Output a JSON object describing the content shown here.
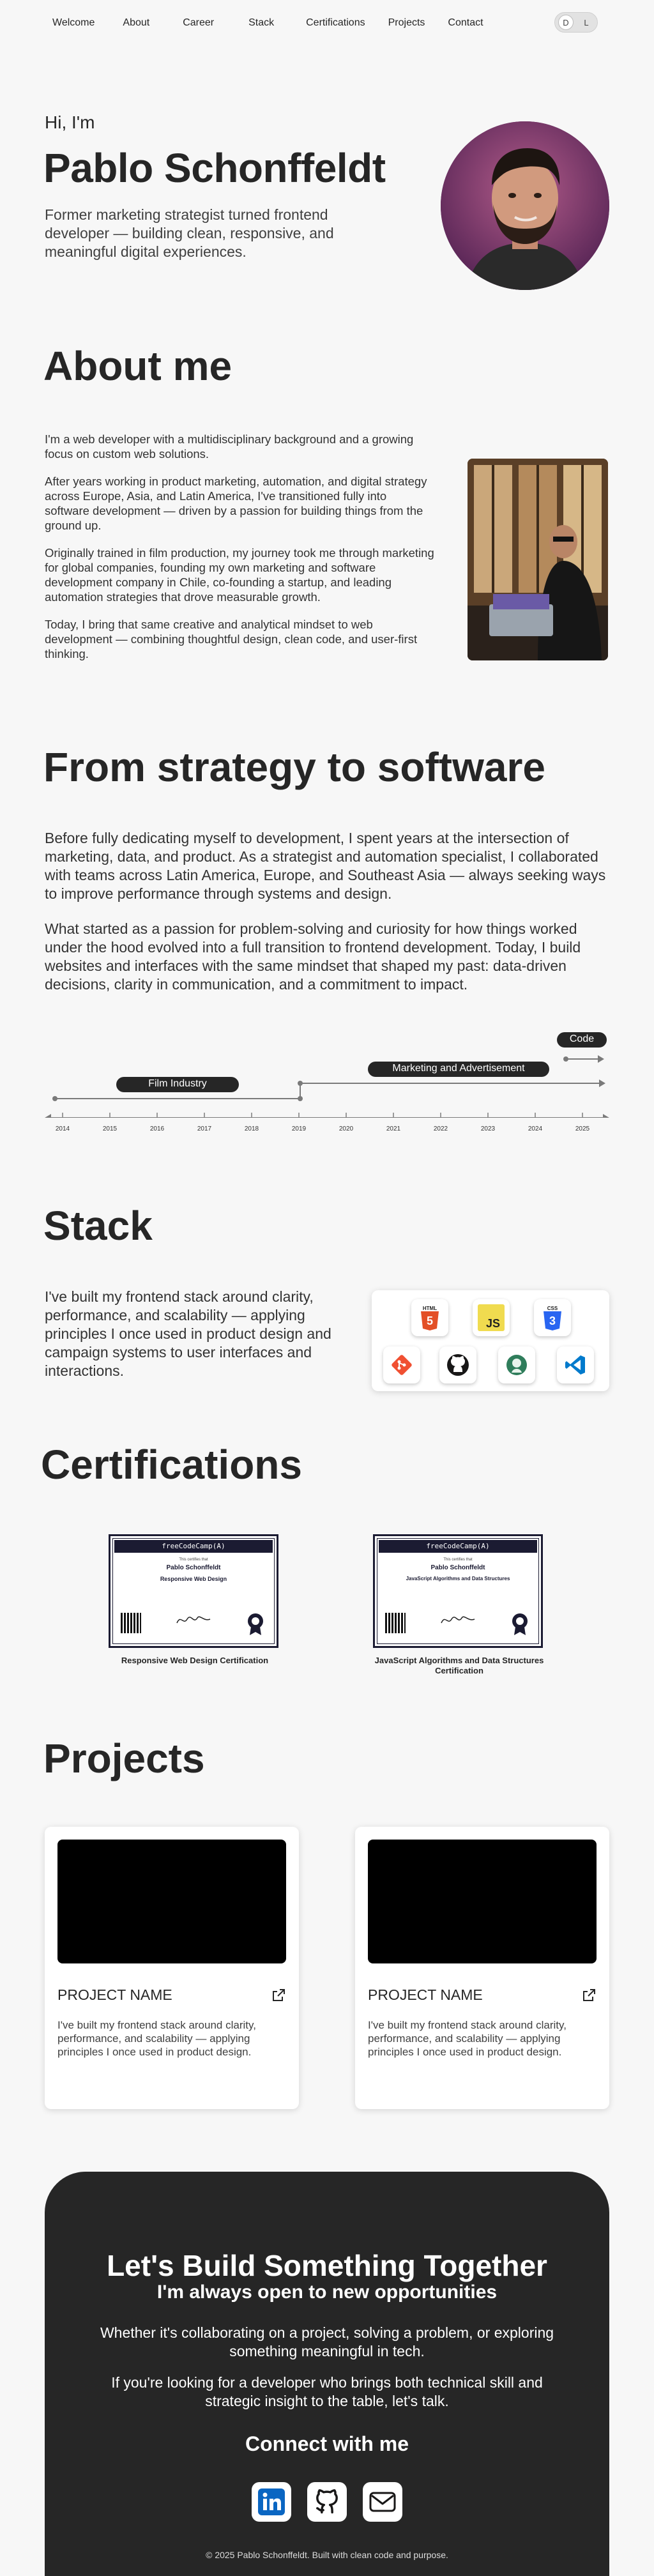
{
  "nav": {
    "links": [
      "Welcome",
      "About",
      "Career",
      "Stack",
      "Certifications",
      "Projects",
      "Contact"
    ],
    "toggle": {
      "dark_label": "D",
      "light_label": "L"
    }
  },
  "hero": {
    "greeting": "Hi, I'm",
    "name": "Pablo Schonffeldt",
    "tagline": "Former marketing strategist turned frontend developer — building clean, responsive, and meaningful digital experiences."
  },
  "about": {
    "title": "About me",
    "paragraphs": [
      "I'm a web developer with a multidisciplinary background and a growing focus on custom web solutions.",
      "After years working in product marketing, automation, and digital strategy across Europe, Asia, and Latin America, I've transitioned fully into software development — driven by a passion for building things from the ground up.",
      "Originally trained in film production, my journey took me through marketing for global companies, founding my own marketing and software development company in Chile, co-founding a startup, and leading automation strategies that drove measurable growth.",
      "Today, I bring that same creative and analytical mindset to web development — combining thoughtful design, clean code, and user-first thinking."
    ]
  },
  "career": {
    "title": "From strategy to software",
    "paragraphs": [
      "Before fully dedicating myself to development, I spent years at the intersection of marketing, data, and product. As a strategist and automation specialist, I collaborated with teams across Latin America, Europe, and Southeast Asia — always seeking ways to improve performance through systems and design.",
      "What started as a passion for problem-solving and curiosity for how things worked under the hood evolved into a full transition to frontend development. Today, I build websites and interfaces with the same mindset that shaped my past: data-driven decisions, clarity in communication, and a commitment to impact."
    ],
    "timeline": {
      "phases": [
        "Film Industry",
        "Marketing and Advertisement",
        "Code"
      ],
      "years": [
        "2014",
        "2015",
        "2016",
        "2017",
        "2018",
        "2019",
        "2020",
        "2021",
        "2022",
        "2023",
        "2024",
        "2025"
      ]
    }
  },
  "stack": {
    "title": "Stack",
    "text": "I've built my frontend stack around clarity, performance, and scalability — applying principles I once used in product design and campaign systems to user interfaces and interactions.",
    "icons": [
      {
        "name": "html5-icon",
        "label": "HTML",
        "badge": "5",
        "color": "#e34f26"
      },
      {
        "name": "javascript-icon",
        "label": "JS",
        "color": "#f0db4f"
      },
      {
        "name": "css3-icon",
        "label": "CSS",
        "badge": "3",
        "color": "#2965f1"
      },
      {
        "name": "git-icon",
        "color": "#f05032"
      },
      {
        "name": "github-icon",
        "color": "#181717"
      },
      {
        "name": "node-icon",
        "color": "#3c873a"
      },
      {
        "name": "vscode-icon",
        "color": "#007acc"
      }
    ]
  },
  "certifications": {
    "title": "Certifications",
    "items": [
      {
        "caption": "Responsive Web Design Certification",
        "brand": "freeCodeCamp(A)",
        "issuer_line": "This certifies that",
        "recipient": "Pablo Schonffeldt",
        "course": "Responsive Web Design"
      },
      {
        "caption": "JavaScript Algorithms and Data Structures Certification",
        "brand": "freeCodeCamp(A)",
        "issuer_line": "This certifies that",
        "recipient": "Pablo Schonffeldt",
        "course": "JavaScript Algorithms and Data Structures"
      }
    ]
  },
  "projects": {
    "title": "Projects",
    "items": [
      {
        "name": "PROJECT NAME",
        "description": "I've built my frontend stack around clarity, performance, and scalability — applying principles I once used in product design."
      },
      {
        "name": "PROJECT NAME",
        "description": "I've built my frontend stack around clarity, performance, and scalability — applying principles I once used in product design."
      }
    ]
  },
  "contact": {
    "title": "Let's Build Something Together",
    "subtitle": "I'm always open to new opportunities",
    "p1": "Whether it's collaborating on a project, solving a problem, or exploring something meaningful in tech.",
    "p2": "If you're looking for a developer who brings both technical skill and strategic insight to the table, let's talk.",
    "connect": "Connect with me",
    "socials": [
      "linkedin-icon",
      "github-icon",
      "email-icon"
    ],
    "footer": "© 2025 Pablo Schonffeldt. Built with clean code and purpose."
  }
}
